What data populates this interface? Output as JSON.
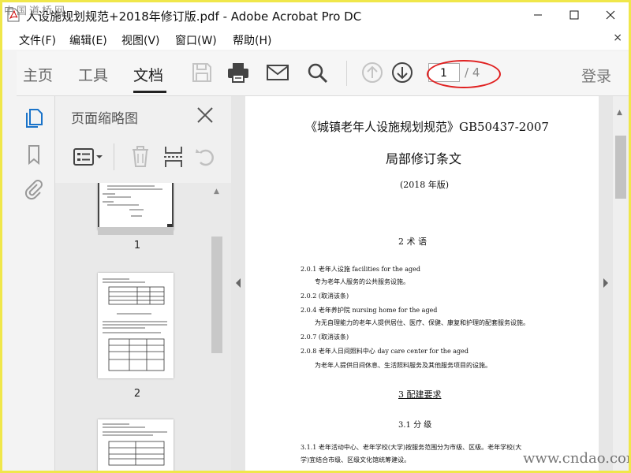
{
  "window": {
    "title": "人设施规划规范+2018年修订版.pdf - Adobe Acrobat Pro DC",
    "watermark_top": "中国道桥网",
    "watermark_bottom": "www.cndao.com"
  },
  "menu": {
    "items": [
      {
        "label": "文件(F)"
      },
      {
        "label": "编辑(E)"
      },
      {
        "label": "视图(V)"
      },
      {
        "label": "窗口(W)"
      },
      {
        "label": "帮助(H)"
      }
    ],
    "close": "×"
  },
  "toolbar": {
    "tabs": [
      {
        "label": "主页"
      },
      {
        "label": "工具"
      },
      {
        "label": "文档"
      }
    ],
    "page_current": "1",
    "page_total": "/ 4",
    "login": "登录"
  },
  "thumbnails": {
    "panel_title": "页面缩略图",
    "pages": [
      {
        "label": "1"
      },
      {
        "label": "2"
      }
    ]
  },
  "document": {
    "title": "《城镇老年人设施规划规范》GB50437-2007",
    "subtitle": "局部修订条文",
    "edition": "(2018 年版)",
    "chapter2": "2   术    语",
    "lines": [
      "2.0.1  老年人设施 facilities for the aged",
      "专为老年人服务的公共服务设施。",
      "2.0.2  (取消该条)",
      "2.0.4  老年养护院 nursing home for the aged",
      "为无自理能力的老年人提供居住、医疗、保健、康复和护理的配套服务设施。",
      "2.0.7  (取消该条)",
      "2.0.8  老年人日间照料中心 day care center for the aged",
      "为老年人提供日间休息、生活照料服务及其他服务项目的设施。"
    ],
    "chapter3": "3   配建要求",
    "section31": "3.1   分    级",
    "line311a": "3.1.1  老年活动中心、老年学校(大学)按服务范围分为市级、区级。老年学校(大",
    "line311b": "学)宜结合市级、区级文化馆统筹建设。"
  },
  "colors": {
    "frame_border": "#f0e74a",
    "annotation_red": "#e02020"
  }
}
